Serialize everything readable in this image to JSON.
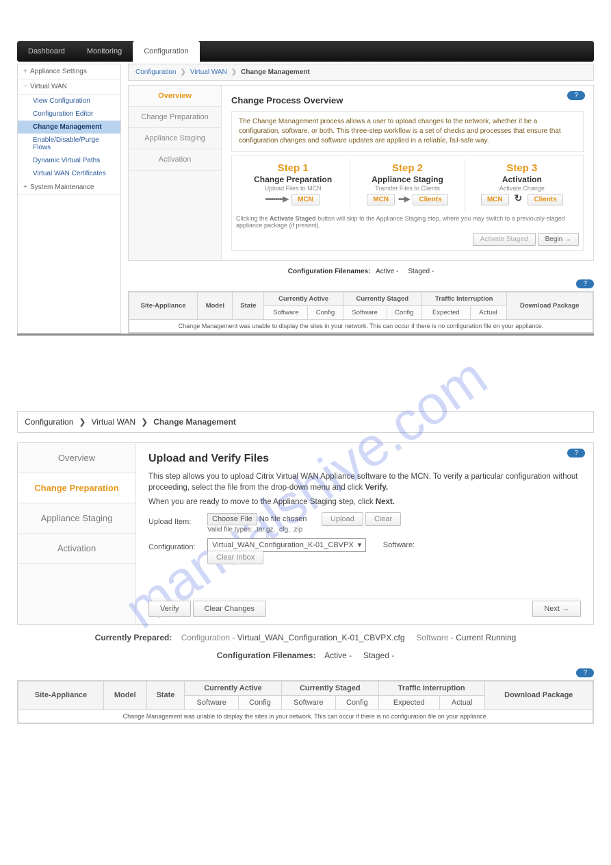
{
  "watermark": "manualshive.com",
  "nav": {
    "tabs": [
      "Dashboard",
      "Monitoring",
      "Configuration"
    ],
    "active": 2
  },
  "sidebar": {
    "grp_appsettings": "Appliance Settings",
    "grp_vwan": "Virtual WAN",
    "items": [
      "View Configuration",
      "Configuration Editor",
      "Change Management",
      "Enable/Disable/Purge Flows",
      "Dynamic Virtual Paths",
      "Virtual WAN Certificates"
    ],
    "grp_sys": "System Maintenance"
  },
  "breadcrumb": {
    "a": "Configuration",
    "b": "Virtual WAN",
    "c": "Change Management"
  },
  "pane1": {
    "tabs": [
      "Overview",
      "Change Preparation",
      "Appliance Staging",
      "Activation"
    ],
    "title": "Change Process Overview",
    "help": "?",
    "intro": "The Change Management process allows a user to upload changes to the network, whether it be a configuration, software, or both. This three-step workflow is a set of checks and processes that ensure that configuration changes and software updates are applied in a reliable, fail-safe way.",
    "steps": {
      "s1": {
        "title": "Step 1",
        "sub": "Change Preparation",
        "desc": "Upload Files to MCN",
        "btn": "MCN"
      },
      "s2": {
        "title": "Step 2",
        "sub": "Appliance Staging",
        "desc": "Transfer Files to Clients",
        "btnA": "MCN",
        "btnB": "Clients"
      },
      "s3": {
        "title": "Step 3",
        "sub": "Activation",
        "desc": "Activate Change",
        "btnA": "MCN",
        "btnB": "Clients"
      }
    },
    "note_prefix": "Clicking the",
    "note_bold": "Activate Staged",
    "note_suffix": "button will skip to the Appliance Staging step, where you may switch to a previously-staged appliance package (if present).",
    "btn_actstaged": "Activate Staged",
    "btn_begin": "Begin →",
    "conf_label": "Configuration Filenames:",
    "conf_active": "Active -",
    "conf_staged": "Staged -",
    "headers": {
      "site": "Site-Appliance",
      "model": "Model",
      "state": "State",
      "ca": "Currently Active",
      "cs": "Currently Staged",
      "ti": "Traffic Interruption",
      "dp": "Download Package",
      "sw": "Software",
      "cfg": "Config",
      "exp": "Expected",
      "act": "Actual"
    },
    "msg": "Change Management was unable to display the sites in your network. This can occur if there is no configuration file on your appliance."
  },
  "pane2": {
    "tabs": [
      "Overview",
      "Change Preparation",
      "Appliance Staging",
      "Activation"
    ],
    "title": "Upload and Verify Files",
    "help": "?",
    "p1a": "This step allows you to upload Citrix Virtual WAN Appliance software to the MCN. To verify a particular configuration without proceeding, select the file from the drop-down menu and click ",
    "p1b": "Verify.",
    "p2a": "When you are ready to move to the Appliance Staging step, click ",
    "p2b": "Next.",
    "upload_lbl": "Upload Item:",
    "choose": "Choose File",
    "nofile": "No file chosen",
    "upload": "Upload",
    "clear": "Clear",
    "valid": "Valid file types: .tar.gz, .cfg, .zip",
    "config_lbl": "Configuration:",
    "select_val": "Virtual_WAN_Configuration_K-01_CBVPX",
    "clearinbox": "Clear Inbox",
    "software_lbl": "Software:",
    "verify": "Verify",
    "clearchanges": "Clear Changes",
    "next": "Next →",
    "prep_lbl": "Currently Prepared:",
    "prep_conf_lbl": "Configuration -",
    "prep_conf_val": "Virtual_WAN_Configuration_K-01_CBVPX.cfg",
    "prep_sw_lbl": "Software -",
    "prep_sw_val": "Current Running",
    "conf_label": "Configuration Filenames:",
    "conf_active": "Active -",
    "conf_staged": "Staged -"
  }
}
